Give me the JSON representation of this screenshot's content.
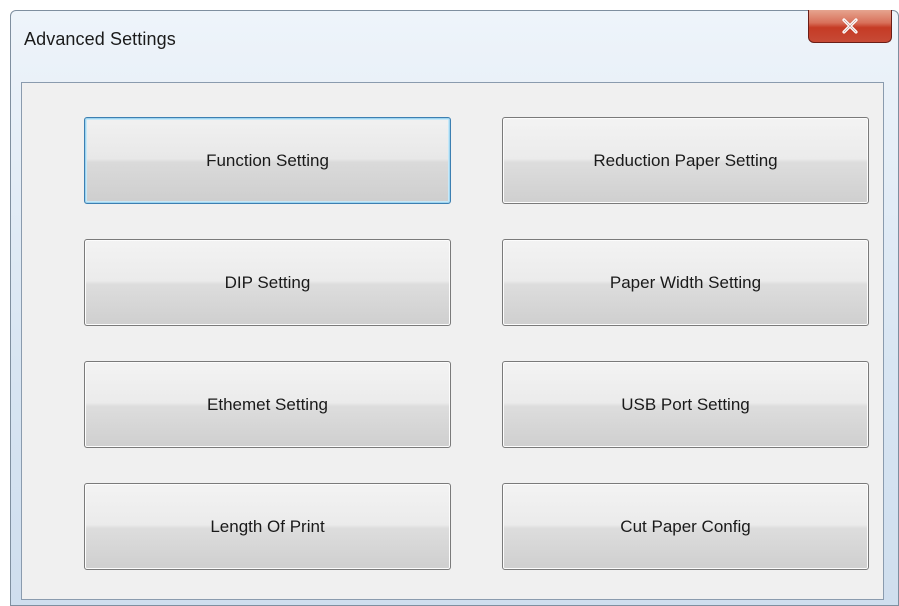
{
  "window": {
    "title": "Advanced Settings",
    "close_icon": "close-icon"
  },
  "buttons": {
    "function_setting": "Function Setting",
    "reduction_paper_setting": "Reduction Paper Setting",
    "dip_setting": "DIP Setting",
    "paper_width_setting": "Paper Width Setting",
    "ethernet_setting": "Ethemet Setting",
    "usb_port_setting": "USB Port Setting",
    "length_of_print": "Length Of Print",
    "cut_paper_config": "Cut Paper Config"
  },
  "colors": {
    "close_button": "#c74a36",
    "focus_border": "#3c7fb1"
  }
}
